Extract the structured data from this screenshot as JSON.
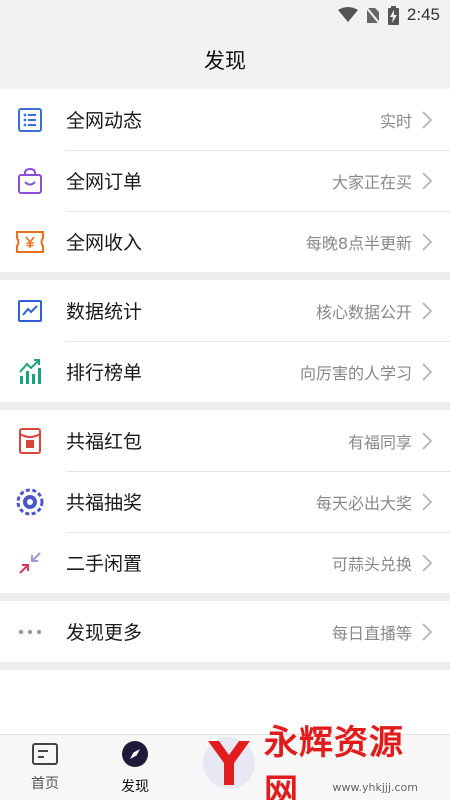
{
  "status_bar": {
    "time": "2:45",
    "icons": [
      "wifi-icon",
      "no-sim-icon",
      "battery-charging-icon"
    ]
  },
  "header": {
    "title": "发现"
  },
  "groups": [
    [
      {
        "icon": "list-icon",
        "label": "全网动态",
        "hint": "实时",
        "color": "#3a6fd8"
      },
      {
        "icon": "shopping-bag-icon",
        "label": "全网订单",
        "hint": "大家正在买",
        "color": "#8a4fd8"
      },
      {
        "icon": "ticket-yuan-icon",
        "label": "全网收入",
        "hint": "每晚8点半更新",
        "color": "#e8701c"
      }
    ],
    [
      {
        "icon": "line-chart-icon",
        "label": "数据统计",
        "hint": "核心数据公开",
        "color": "#2f5fd0"
      },
      {
        "icon": "ranking-bars-icon",
        "label": "排行榜单",
        "hint": "向厉害的人学习",
        "color": "#1aa37a"
      }
    ],
    [
      {
        "icon": "red-envelope-icon",
        "label": "共福红包",
        "hint": "有福同享",
        "color": "#d9453a"
      },
      {
        "icon": "lottery-wheel-icon",
        "label": "共福抽奖",
        "hint": "每天必出大奖",
        "color": "#4b57c9"
      },
      {
        "icon": "swap-arrows-icon",
        "label": "二手闲置",
        "hint": "可蒜头兑换",
        "color": "#e0355a"
      }
    ],
    [
      {
        "icon": "more-dots-icon",
        "label": "发现更多",
        "hint": "每日直播等",
        "color": "#999999"
      }
    ]
  ],
  "tabbar": {
    "tabs": [
      {
        "icon": "home-icon",
        "label": "首页",
        "active": false
      },
      {
        "icon": "compass-icon",
        "label": "发现",
        "active": true
      }
    ]
  },
  "watermark": {
    "text": "永辉资源网",
    "url": "www.yhkjjj.com"
  }
}
